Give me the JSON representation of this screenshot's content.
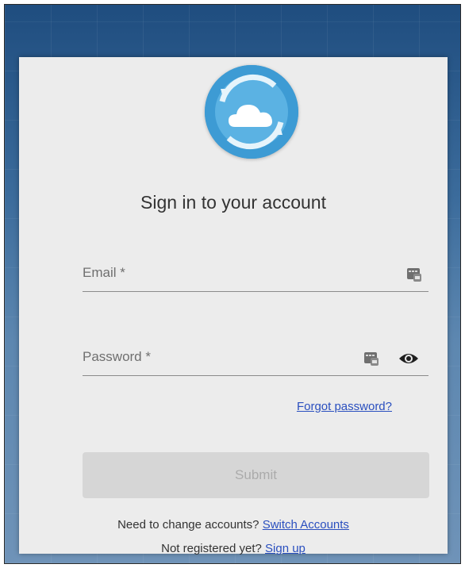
{
  "header": {
    "title": "Sign in to your account"
  },
  "form": {
    "email_label": "Email *",
    "email_value": "",
    "password_label": "Password *",
    "password_value": "",
    "forgot_link": "Forgot password?",
    "submit_label": "Submit"
  },
  "footer": {
    "change_prompt": "Need to change accounts?",
    "switch_link": "Switch Accounts",
    "register_prompt": "Not registered yet?",
    "signup_link": "Sign up"
  },
  "icons": {
    "logo": "cloud-sync-icon",
    "field_helper": "password-manager-key-icon",
    "toggle_visibility": "eye-icon"
  },
  "colors": {
    "logo_blue": "#3d9bd4",
    "link": "#2a4fbf",
    "submit_disabled": "#d6d6d6",
    "card": "#ececec"
  }
}
